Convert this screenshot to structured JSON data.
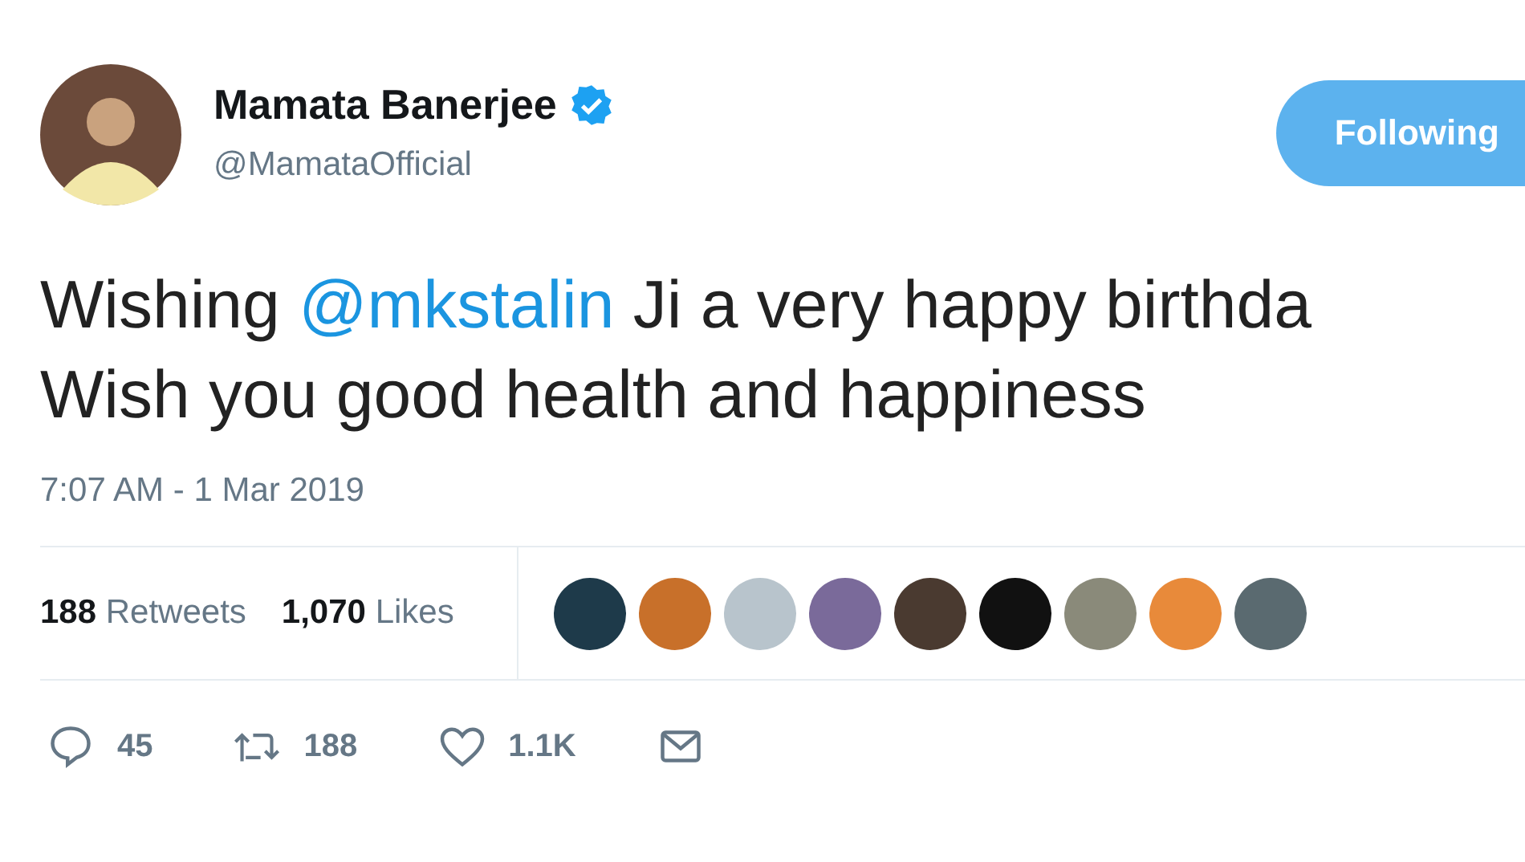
{
  "author": {
    "name": "Mamata Banerjee",
    "verified": true,
    "handle": "@MamataOfficial"
  },
  "follow_button": {
    "label": "Following"
  },
  "tweet": {
    "lines": [
      [
        {
          "kind": "text",
          "text": "Wishing"
        },
        {
          "kind": "mention",
          "text": "@mkstalin"
        },
        {
          "kind": "text",
          "text": "Ji a very happy birthda"
        }
      ],
      [
        {
          "kind": "text",
          "text": "Wish you good health and happiness"
        }
      ]
    ],
    "timestamp": "7:07 AM - 1 Mar 2019"
  },
  "stats": [
    {
      "count": "188",
      "label": "Retweets"
    },
    {
      "count": "1,070",
      "label": "Likes"
    }
  ],
  "liker_avatars": [
    {
      "color": "#1e3a4a"
    },
    {
      "color": "#c8702a"
    },
    {
      "color": "#b8c4cc"
    },
    {
      "color": "#7a6a9a"
    },
    {
      "color": "#4a3a30"
    },
    {
      "color": "#111111"
    },
    {
      "color": "#8a8a7a"
    },
    {
      "color": "#e88a3a"
    },
    {
      "color": "#5a6a70"
    }
  ],
  "actions": [
    {
      "kind": "reply",
      "count": "45"
    },
    {
      "kind": "retweet",
      "count": "188"
    },
    {
      "kind": "like",
      "count": "1.1K"
    },
    {
      "kind": "message"
    }
  ]
}
